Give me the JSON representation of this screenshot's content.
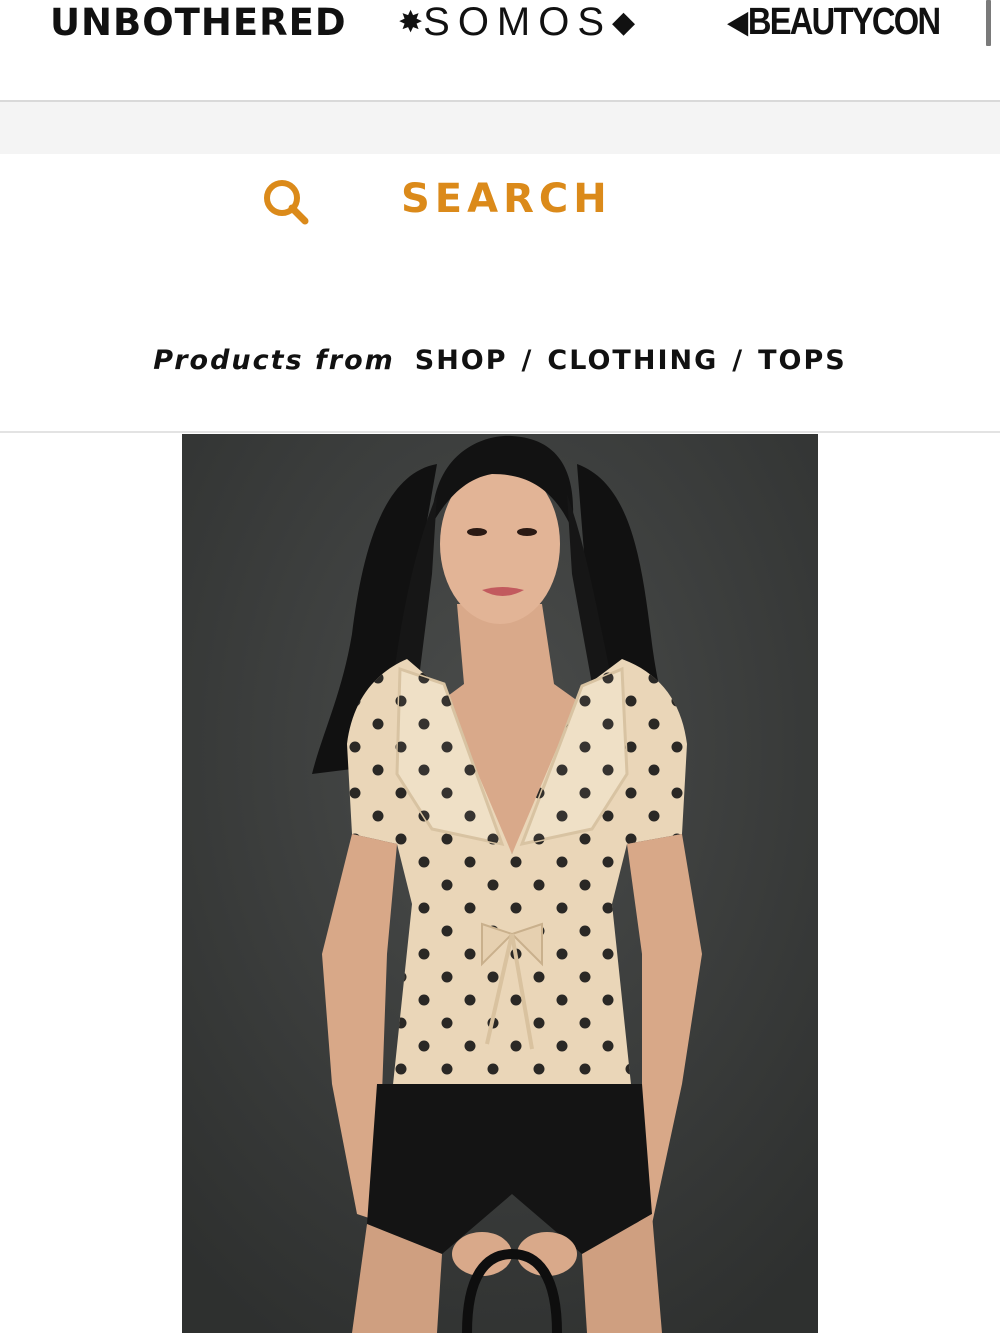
{
  "brand_strip": {
    "brands": [
      {
        "label": "UNBOTHERED"
      },
      {
        "prefix_glyph": "✸",
        "label": "SOMOS",
        "suffix_glyph": "◆"
      },
      {
        "prefix_glyph": "◀",
        "label": "BEAUTYCON"
      }
    ]
  },
  "search": {
    "icon": "search-icon",
    "label": "SEARCH",
    "accent_color": "#db8a1a"
  },
  "breadcrumb": {
    "prefix": "Products from",
    "items": [
      "SHOP",
      "CLOTHING",
      "TOPS"
    ],
    "separator": "/"
  },
  "product": {
    "image_description": "Model wearing cream polka-dot peplum top with ruffled collar and tie front, black shorts"
  }
}
